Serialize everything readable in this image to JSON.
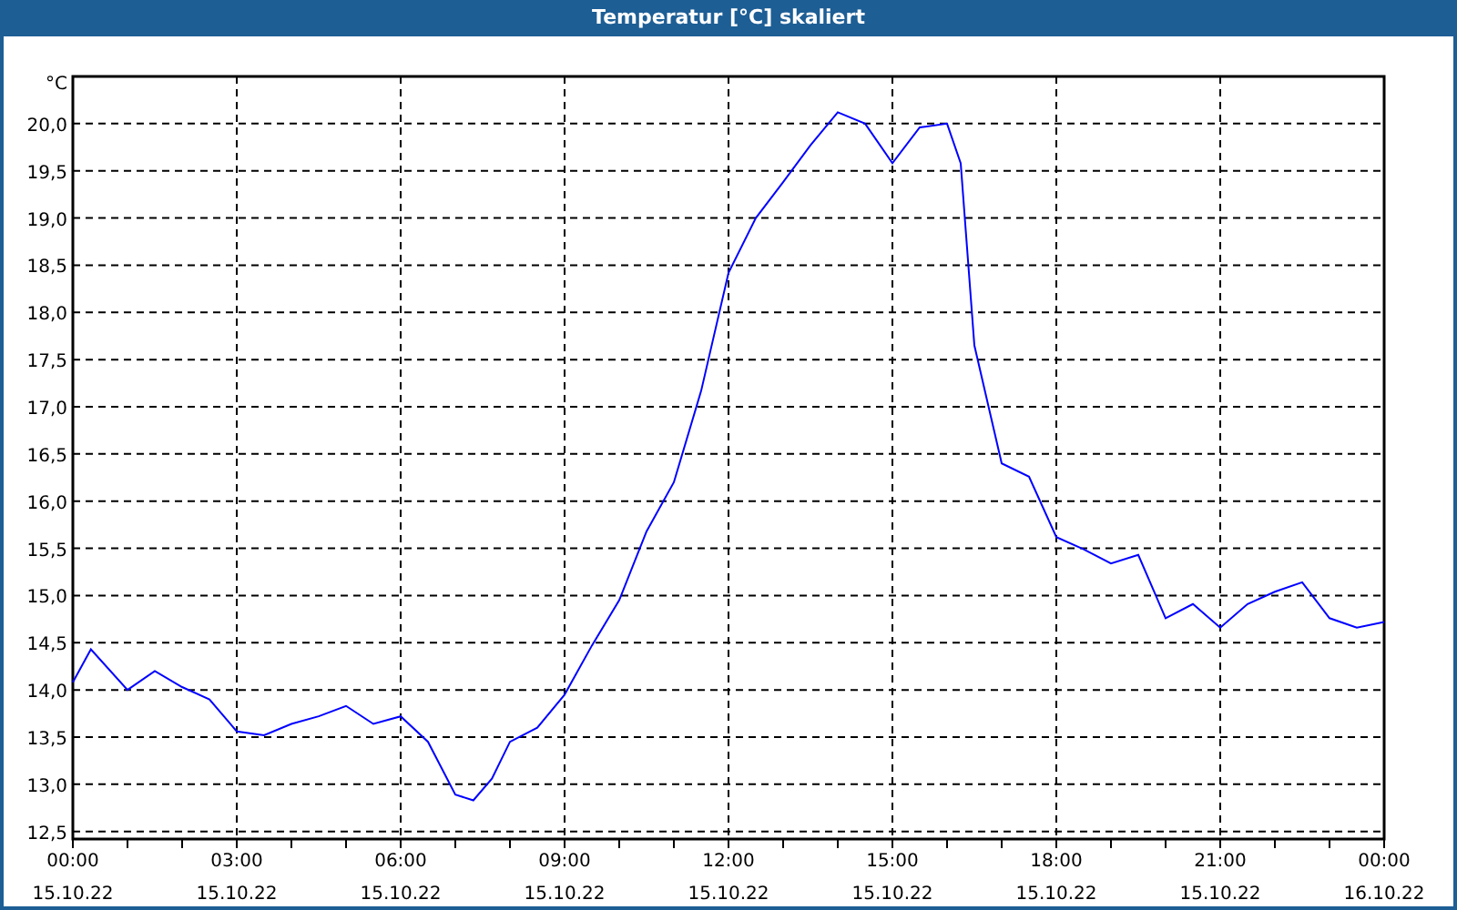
{
  "window": {
    "title": "Temperatur [°C] skaliert"
  },
  "chart": {
    "date_labels": [
      "15.10.22",
      "15.10.22",
      "15.10.22",
      "15.10.22",
      "15.10.22",
      "15.10.22",
      "15.10.22",
      "15.10.22",
      "16.10.22"
    ],
    "chart_data": {
      "type": "line",
      "ylabel": "°C",
      "x": [
        0,
        0.33,
        1,
        1.5,
        2,
        2.5,
        3,
        3.5,
        4,
        4.5,
        5,
        5.5,
        6,
        6.5,
        7,
        7.33,
        7.67,
        8,
        8.5,
        9,
        9.5,
        10,
        10.5,
        11,
        11.5,
        12,
        12.5,
        13,
        13.5,
        14,
        14.5,
        15,
        15.5,
        16,
        16.25,
        16.5,
        17,
        17.5,
        18,
        18.5,
        19,
        19.5,
        20,
        20.5,
        21,
        21.5,
        22,
        22.5,
        23,
        23.5,
        24
      ],
      "grid": true,
      "series": [
        {
          "color": "#0000ff",
          "values": [
            14.08,
            14.43,
            14.0,
            14.2,
            14.03,
            13.9,
            13.56,
            13.52,
            13.64,
            13.72,
            13.83,
            13.64,
            13.72,
            13.45,
            12.89,
            12.83,
            13.06,
            13.45,
            13.6,
            13.95,
            14.47,
            14.95,
            15.68,
            16.2,
            17.17,
            18.42,
            19.0,
            19.38,
            19.77,
            20.12,
            20.0,
            19.58,
            19.96,
            20.0,
            19.58,
            17.65,
            16.4,
            16.26,
            15.62,
            15.49,
            15.34,
            15.43,
            14.76,
            14.91,
            14.66,
            14.91,
            15.04,
            15.14,
            14.76,
            14.66,
            14.72
          ]
        }
      ],
      "xlim": [
        0,
        24
      ],
      "ylim": [
        12.42,
        20.5
      ],
      "xticks": [
        {
          "value": 0,
          "label": "00:00"
        },
        {
          "value": 3,
          "label": "03:00"
        },
        {
          "value": 6,
          "label": "06:00"
        },
        {
          "value": 9,
          "label": "09:00"
        },
        {
          "value": 12,
          "label": "12:00"
        },
        {
          "value": 15,
          "label": "15:00"
        },
        {
          "value": 18,
          "label": "18:00"
        },
        {
          "value": 21,
          "label": "21:00"
        },
        {
          "value": 24,
          "label": "00:00"
        }
      ],
      "yticks": [
        {
          "value": 12.5,
          "label": "12,5"
        },
        {
          "value": 13,
          "label": "13,0"
        },
        {
          "value": 13.5,
          "label": "13,5"
        },
        {
          "value": 14,
          "label": "14,0"
        },
        {
          "value": 14.5,
          "label": "14,5"
        },
        {
          "value": 15,
          "label": "15,0"
        },
        {
          "value": 15.5,
          "label": "15,5"
        },
        {
          "value": 16,
          "label": "16,0"
        },
        {
          "value": 16.5,
          "label": "16,5"
        },
        {
          "value": 17,
          "label": "17,0"
        },
        {
          "value": 17.5,
          "label": "17,5"
        },
        {
          "value": 18,
          "label": "18,0"
        },
        {
          "value": 18.5,
          "label": "18,5"
        },
        {
          "value": 19,
          "label": "19,0"
        },
        {
          "value": 19.5,
          "label": "19,5"
        },
        {
          "value": 20,
          "label": "20,0"
        }
      ]
    }
  }
}
